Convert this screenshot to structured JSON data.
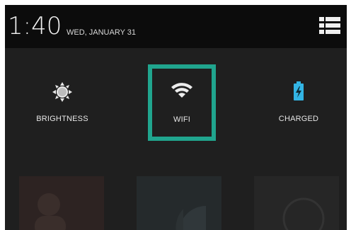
{
  "status_bar": {
    "time": "1:40",
    "date": "WED, JANUARY 31",
    "menu_icon": "list-menu-icon"
  },
  "quick_settings": [
    {
      "label": "BRIGHTNESS",
      "icon": "brightness-icon"
    },
    {
      "label": "WIFI",
      "icon": "wifi-icon",
      "highlighted": true
    },
    {
      "label": "CHARGED",
      "icon": "battery-charging-icon"
    }
  ],
  "colors": {
    "highlight": "#20a58e",
    "battery": "#33b5e5"
  }
}
